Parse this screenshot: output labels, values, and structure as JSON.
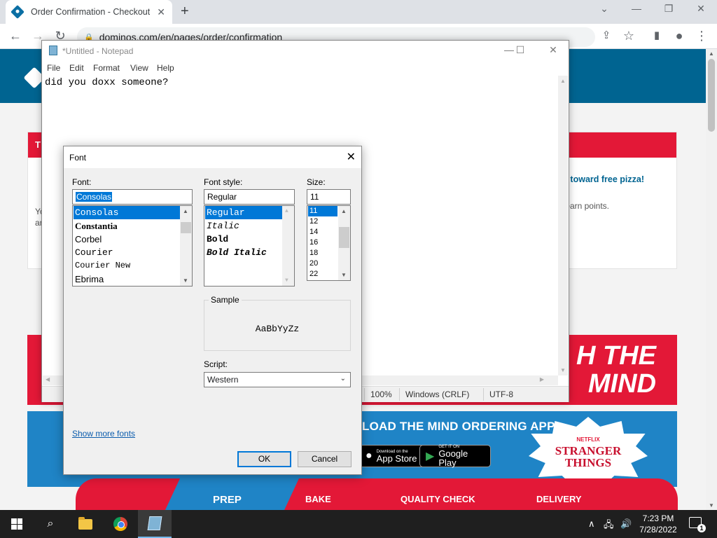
{
  "browser": {
    "tab_title": "Order Confirmation - Checkout C",
    "tab_close": "✕",
    "new_tab": "+",
    "url": "dominos.com/en/pages/order/confirmation",
    "window_controls": {
      "minimize": "⌄",
      "restore_tabs": "—",
      "maximize": "❐",
      "close": "✕"
    },
    "nav": {
      "back": "←",
      "forward": "→",
      "reload": "↻",
      "lock": "🔒",
      "share": "⇪",
      "star": "☆",
      "sidepanel": "▮",
      "profile": "●",
      "menu": "⋮"
    }
  },
  "site": {
    "rewards_free": "toward free pizza!",
    "rewards_earn": "earn points.",
    "card_left_1": "Yo",
    "card_left_2": "ar",
    "card_top_letter": "T",
    "promo_line1": "H THE",
    "promo_line2": "MIND",
    "download_text": "LOAD THE MIND ORDERING APP",
    "app_store_small": "Download on the",
    "app_store_big": "App Store",
    "google_play_small": "GET IT ON",
    "google_play_big": "Google Play",
    "netflix": "NETFLIX",
    "stranger_things_1": "STRANGER",
    "stranger_things_2": "THINGS",
    "steps": [
      "PREP",
      "BAKE",
      "QUALITY CHECK",
      "DELIVERY"
    ]
  },
  "notepad": {
    "title": "*Untitled - Notepad",
    "menu": [
      "File",
      "Edit",
      "Format",
      "View",
      "Help"
    ],
    "content": "did you doxx someone?",
    "status": {
      "zoom": "100%",
      "line_ending": "Windows (CRLF)",
      "encoding": "UTF-8"
    },
    "controls": {
      "minimize": "—",
      "maximize": "☐",
      "close": "✕"
    }
  },
  "font_dialog": {
    "title": "Font",
    "close": "✕",
    "font_label": "Font:",
    "font_value": "Consolas",
    "fonts": [
      "Consolas",
      "Constantia",
      "Corbel",
      "Courier",
      "Courier New",
      "Ebrima"
    ],
    "style_label": "Font style:",
    "style_value": "Regular",
    "styles": [
      "Regular",
      "Italic",
      "Bold",
      "Bold Italic"
    ],
    "size_label": "Size:",
    "size_value": "11",
    "sizes": [
      "11",
      "12",
      "14",
      "16",
      "18",
      "20",
      "22"
    ],
    "sample_label": "Sample",
    "sample_text": "AaBbYyZz",
    "script_label": "Script:",
    "script_value": "Western",
    "show_more_fonts": "Show more fonts",
    "ok": "OK",
    "cancel": "Cancel"
  },
  "taskbar": {
    "time": "7:23 PM",
    "date": "7/28/2022",
    "notifications": "1",
    "tray": {
      "chevron": "∧",
      "network": "🖧",
      "volume": "🔊"
    }
  }
}
